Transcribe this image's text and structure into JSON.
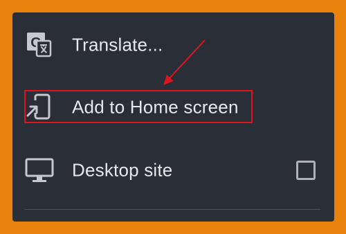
{
  "menu": {
    "items": [
      {
        "label": "Translate...",
        "icon": "translate-icon"
      },
      {
        "label": "Add to Home screen",
        "icon": "add-to-home-screen-icon"
      },
      {
        "label": "Desktop site",
        "icon": "desktop-icon",
        "checkbox_checked": false
      }
    ]
  },
  "annotation": {
    "color": "#E0141E"
  },
  "colors": {
    "background": "#E8820C",
    "menu_background": "#2A2E36",
    "text": "#E6E8EC",
    "icon": "#C5C8CE"
  }
}
